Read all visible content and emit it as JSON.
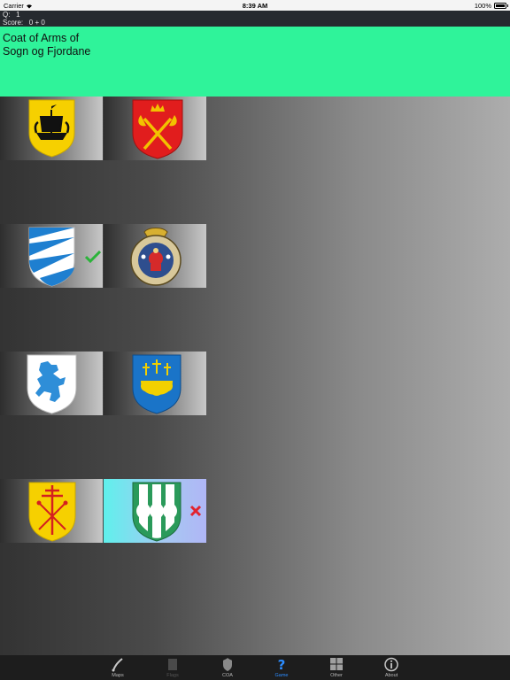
{
  "status": {
    "carrier": "Carrier",
    "time": "8:39 AM",
    "battery": "100%"
  },
  "game": {
    "question_label": "Q:",
    "question_value": "1",
    "score_label": "Score:",
    "score_value": "0 + 0"
  },
  "banner": {
    "line1": "Coat of Arms of",
    "line2": "Sogn og Fjordane"
  },
  "tiles": [
    {
      "icon": "ship-shield-icon",
      "bg": "#f6d000",
      "state": "none"
    },
    {
      "icon": "crossed-axes-crown-shield-icon",
      "bg": "#e11d1d",
      "state": "none"
    },
    {
      "icon": "wedges-shield-icon",
      "bg": "#1e7fd0",
      "state": "correct"
    },
    {
      "icon": "round-seal-icon",
      "bg": "#2e4e8e",
      "state": "none"
    },
    {
      "icon": "bear-shield-icon",
      "bg": "#ffffff",
      "state": "none"
    },
    {
      "icon": "crosses-bells-shield-icon",
      "bg": "#1a74c8",
      "state": "none"
    },
    {
      "icon": "patriarchal-cross-shield-icon",
      "bg": "#f6d000",
      "state": "none"
    },
    {
      "icon": "white-pillars-shield-icon",
      "bg": "#2a9a5a",
      "state": "wrong"
    }
  ],
  "tabs": [
    {
      "label": "Maps",
      "icon": "map-pen-icon",
      "state": "normal"
    },
    {
      "label": "Flags",
      "icon": "flag-icon",
      "state": "disabled"
    },
    {
      "label": "COA",
      "icon": "shield-icon",
      "state": "normal"
    },
    {
      "label": "Game",
      "icon": "question-icon",
      "state": "active"
    },
    {
      "label": "Other",
      "icon": "grid-icon",
      "state": "normal"
    },
    {
      "label": "About",
      "icon": "info-icon",
      "state": "normal"
    }
  ],
  "colors": {
    "banner": "#2ff39a",
    "active_tab": "#2c8cff",
    "correct": "#2bb33a",
    "wrong": "#e2232e"
  }
}
